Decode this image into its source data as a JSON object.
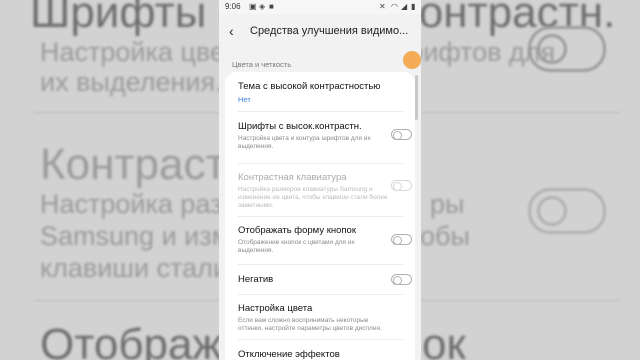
{
  "status_bar": {
    "time": "9:06"
  },
  "app_bar": {
    "title": "Средства улучшения видимо...",
    "back_icon": "arrow-left-icon"
  },
  "section_header": "Цвета и четкость",
  "items": [
    {
      "title": "Тема с высокой контрастностью",
      "value": "Нет"
    },
    {
      "title": "Шрифты с высок.контрастн.",
      "subtitle": "Настройка цвета и контура шрифтов для их выделения.",
      "toggle": false
    },
    {
      "title": "Контрастная клавиатура",
      "subtitle": "Настройка размеров клавиатуры Samsung и изменение ее цвета, чтобы клавиши стали более заметными.",
      "toggle": false,
      "disabled": true
    },
    {
      "title": "Отображать форму кнопок",
      "subtitle": "Отображение кнопок с цветами для их выделения.",
      "toggle": false
    },
    {
      "title": "Негатив",
      "toggle": false
    },
    {
      "title": "Настройка цвета",
      "subtitle": "Если вам сложно воспринимать некоторые оттенки, настройте параметры цветов дисплея."
    },
    {
      "title": "Отключение эффектов"
    }
  ],
  "background_zoom": {
    "line1": "Шрифты с высококонтрастн.",
    "line2": "Настройка цвета и контура шрифтов для",
    "line3": "их выделения.",
    "line4": "Контрастная",
    "line5": "Настройка разм",
    "line6": "Samsung и изме",
    "line7": "клавиши стали б",
    "line8": "Отображать",
    "line5b": "ры",
    "line6b": "обы",
    "line8b": "ок"
  },
  "colors": {
    "accent": "#3e7fd6",
    "touch": "#f5a03c"
  }
}
